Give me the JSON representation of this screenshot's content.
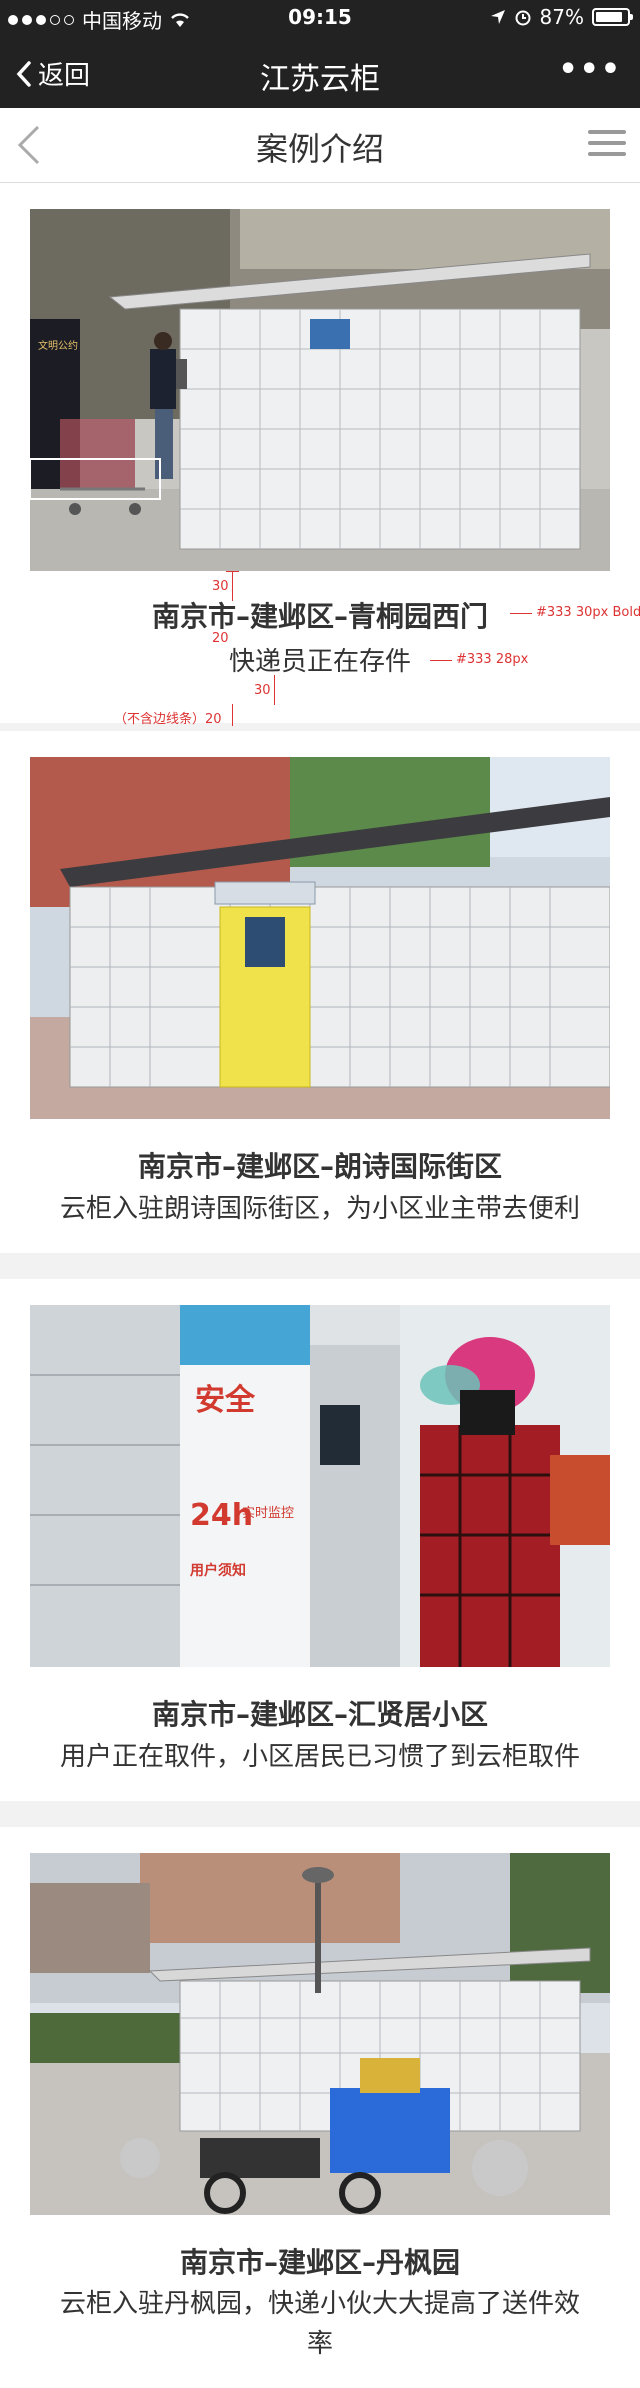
{
  "status": {
    "carrier": "中国移动",
    "time": "09:15",
    "battery": "87%",
    "battery_level": 0.87
  },
  "nav": {
    "back_label": "返回",
    "title": "江苏云柜",
    "more": "•••"
  },
  "page": {
    "title": "案例介绍"
  },
  "cases": [
    {
      "title": "南京市–建邺区–青桐园西门",
      "desc": "快递员正在存件"
    },
    {
      "title": "南京市–建邺区–朗诗国际街区",
      "desc": "云柜入驻朗诗国际街区，为小区业主带去便利"
    },
    {
      "title": "南京市–建邺区–汇贤居小区",
      "desc": "用户正在取件，小区居民已习惯了到云柜取件"
    },
    {
      "title": "南京市–建邺区–丹枫园",
      "desc": "云柜入驻丹枫园，快递小伙大大提高了送件效率"
    }
  ],
  "annotations": {
    "title_spec": "#333  30px Bold",
    "desc_spec": "#333  28px",
    "gap_top": "30",
    "gap_mid": "20",
    "gap_desc": "30",
    "gap_bottom_label": "（不含边线条）20"
  },
  "photo_text": {
    "sign_a": "安全",
    "sign_b": "24h",
    "sign_c": "实时监控",
    "sign_d": "用户须知",
    "board": "文明公约"
  }
}
